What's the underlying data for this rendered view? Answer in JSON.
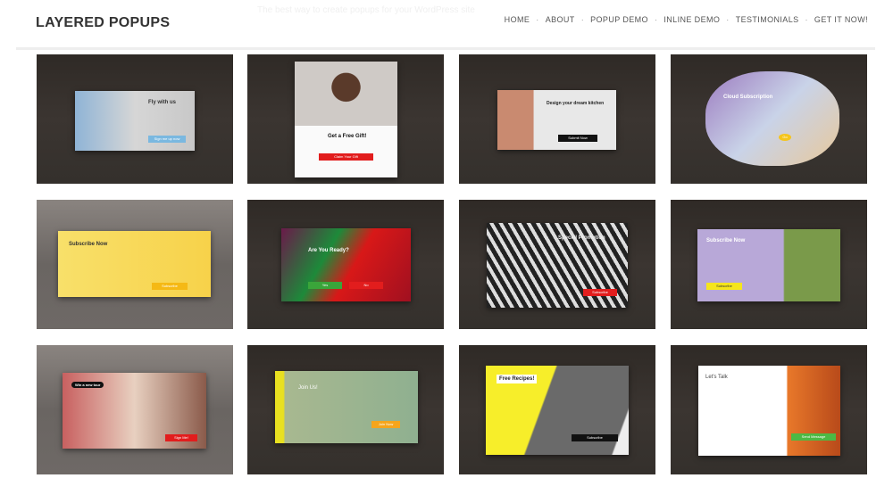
{
  "header": {
    "logo": "LAYERED POPUPS",
    "tagline": "The best way to create popups for your WordPress site",
    "nav": [
      "HOME",
      "ABOUT",
      "POPUP DEMO",
      "INLINE DEMO",
      "TESTIMONIALS",
      "GET IT NOW!"
    ]
  },
  "tiles": [
    {
      "title": "Fly with us",
      "button": "Sign me up now"
    },
    {
      "title": "Get a Free Gift!",
      "button": "Claim Your Gift"
    },
    {
      "title": "Design your dream kitchen",
      "button": "Submit Now"
    },
    {
      "title": "Cloud Subscription",
      "button": "Go"
    },
    {
      "title": "Subscribe Now",
      "button": "Subscribe"
    },
    {
      "title": "Are You Ready?",
      "button": "Yes",
      "button2": "No"
    },
    {
      "title": "Special Promotion",
      "button": "Subscribe"
    },
    {
      "title": "Subscribe Now",
      "button": "Subscribe"
    },
    {
      "title": "Win a new tour",
      "button": "Sign Me!"
    },
    {
      "title": "Join Us!",
      "button": "Join Now"
    },
    {
      "title": "Free Recipes!",
      "button": "Subscribe"
    },
    {
      "title": "Let's Talk",
      "button": "Send Message"
    }
  ],
  "colors": {
    "tile_bg": "#3b3531",
    "accent_red": "#e21d1d",
    "accent_yellow": "#f5e51c",
    "accent_green": "#4cb944"
  }
}
